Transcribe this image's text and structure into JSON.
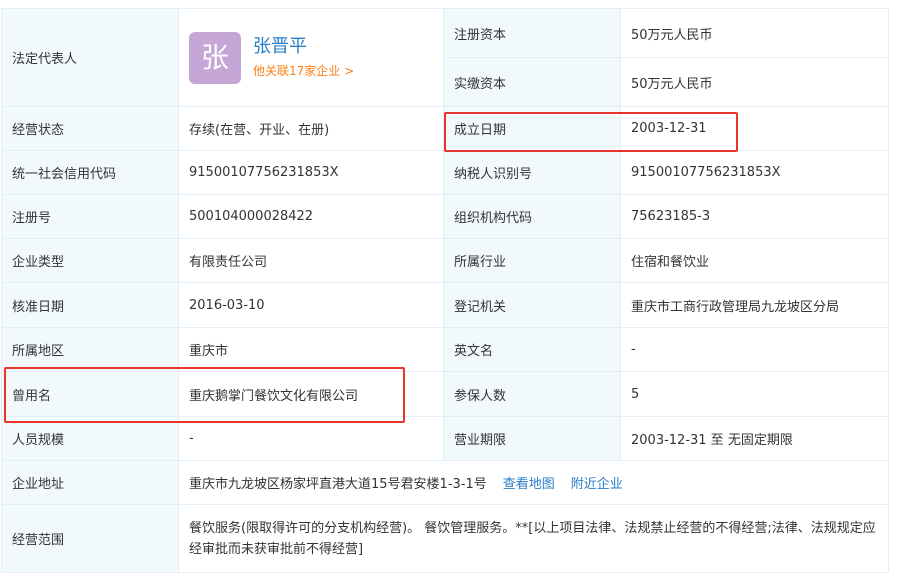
{
  "legal_rep": {
    "label": "法定代表人",
    "avatar_char": "张",
    "name": "张晋平",
    "related_link": "他关联17家企业 >"
  },
  "rows": {
    "reg_capital": {
      "label": "注册资本",
      "value": "50万元人民币"
    },
    "paid_capital": {
      "label": "实缴资本",
      "value": "50万元人民币"
    },
    "status": {
      "label": "经营状态",
      "value": "存续(在营、开业、在册)"
    },
    "established": {
      "label": "成立日期",
      "value": "2003-12-31"
    },
    "credit_code": {
      "label": "统一社会信用代码",
      "value": "91500107756231853X"
    },
    "taxpayer_id": {
      "label": "纳税人识别号",
      "value": "91500107756231853X"
    },
    "reg_no": {
      "label": "注册号",
      "value": "500104000028422"
    },
    "org_code": {
      "label": "组织机构代码",
      "value": "75623185-3"
    },
    "company_type": {
      "label": "企业类型",
      "value": "有限责任公司"
    },
    "industry": {
      "label": "所属行业",
      "value": "住宿和餐饮业"
    },
    "approval_date": {
      "label": "核准日期",
      "value": "2016-03-10"
    },
    "registry": {
      "label": "登记机关",
      "value": "重庆市工商行政管理局九龙坡区分局"
    },
    "region": {
      "label": "所属地区",
      "value": "重庆市"
    },
    "english_name": {
      "label": "英文名",
      "value": "-"
    },
    "former_name": {
      "label": "曾用名",
      "value": "重庆鹅掌门餐饮文化有限公司"
    },
    "insured": {
      "label": "参保人数",
      "value": "5"
    },
    "staff_size": {
      "label": "人员规模",
      "value": "-"
    },
    "term": {
      "label": "营业期限",
      "value": "2003-12-31 至 无固定期限"
    },
    "address": {
      "label": "企业地址",
      "value": "重庆市九龙坡区杨家坪直港大道15号君安楼1-3-1号",
      "map_link": "查看地图",
      "nearby_link": "附近企业"
    },
    "scope": {
      "label": "经营范围",
      "value": "餐饮服务(限取得许可的分支机构经营)。 餐饮管理服务。**[以上项目法律、法规禁止经营的不得经营;法律、法规规定应经审批而未获审批前不得经营]"
    }
  },
  "colors": {
    "label_bg": "#f2f9fc",
    "border": "#e4eef6",
    "link": "#2a7ec8",
    "orange": "#fd7e14",
    "highlight": "#e8352b"
  }
}
